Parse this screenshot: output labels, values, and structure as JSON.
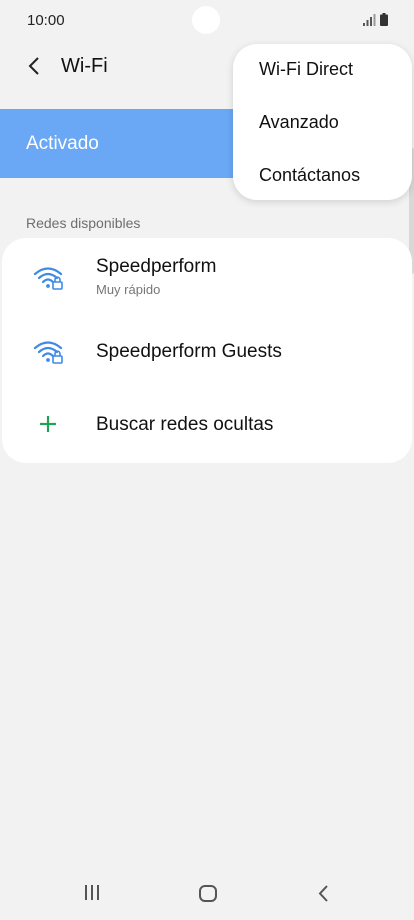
{
  "status": {
    "time": "10:00"
  },
  "header": {
    "title": "Wi-Fi"
  },
  "master": {
    "label": "Activado"
  },
  "menu": {
    "items": [
      "Wi-Fi Direct",
      "Avanzado",
      "Contáctanos"
    ]
  },
  "networks": {
    "section_label": "Redes disponibles",
    "items": [
      {
        "name": "Speedperform",
        "subtitle": "Muy rápido"
      },
      {
        "name": "Speedperform Guests",
        "subtitle": ""
      }
    ],
    "add_label": "Buscar redes ocultas"
  },
  "colors": {
    "accent": "#6aa7f5",
    "wifi_icon": "#3e8ae6",
    "add_icon": "#1fa355"
  }
}
